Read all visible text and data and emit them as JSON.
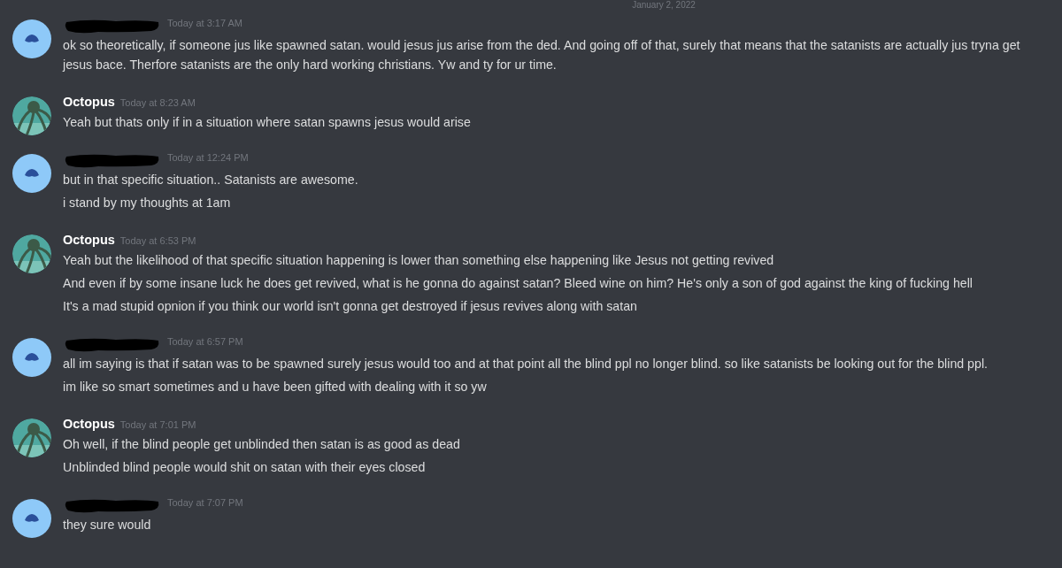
{
  "date_divider": "January 2, 2022",
  "messages": [
    {
      "author": {
        "kind": "redacted"
      },
      "avatar": {
        "kind": "default"
      },
      "time": "Today at 3:17 AM",
      "lines": [
        "ok so theoretically, if someone jus like spawned satan. would jesus jus arise from the ded. And going off of that, surely that means that the satanists are actually jus tryna get jesus bace. Therfore satanists are the only hard working christians. Yw and ty for ur time."
      ]
    },
    {
      "author": {
        "kind": "named",
        "name": "Octopus"
      },
      "avatar": {
        "kind": "picture"
      },
      "time": "Today at 8:23 AM",
      "lines": [
        "Yeah but thats only if in a situation where satan spawns jesus would arise"
      ]
    },
    {
      "author": {
        "kind": "redacted"
      },
      "avatar": {
        "kind": "default"
      },
      "time": "Today at 12:24 PM",
      "lines": [
        "but in that specific situation.. Satanists are awesome.",
        "i stand by my thoughts at 1am"
      ]
    },
    {
      "author": {
        "kind": "named",
        "name": "Octopus"
      },
      "avatar": {
        "kind": "picture"
      },
      "time": "Today at 6:53 PM",
      "lines": [
        "Yeah but the likelihood of that specific situation happening is lower than something else happening like Jesus not getting revived",
        "And even if by some insane luck he does get revived, what is he gonna do against satan? Bleed wine on him? He's only a son of god against the king of fucking hell",
        "It's a mad stupid opnion if you think our world isn't gonna get destroyed if jesus revives along with satan"
      ]
    },
    {
      "author": {
        "kind": "redacted"
      },
      "avatar": {
        "kind": "default"
      },
      "time": "Today at 6:57 PM",
      "lines": [
        "all im saying is that if satan was to be spawned surely jesus would too and at that point all the blind ppl no longer blind. so like satanists be looking out for the blind ppl.",
        "im like so smart sometimes and u have been gifted with dealing with it so yw"
      ]
    },
    {
      "author": {
        "kind": "named",
        "name": "Octopus"
      },
      "avatar": {
        "kind": "picture"
      },
      "time": "Today at 7:01 PM",
      "lines": [
        "Oh well, if the blind people get unblinded then satan is as good as dead",
        "Unblinded blind people would shit on satan with their eyes closed"
      ]
    },
    {
      "author": {
        "kind": "redacted"
      },
      "avatar": {
        "kind": "default"
      },
      "time": "Today at 7:07 PM",
      "lines": [
        "they sure would"
      ]
    }
  ]
}
